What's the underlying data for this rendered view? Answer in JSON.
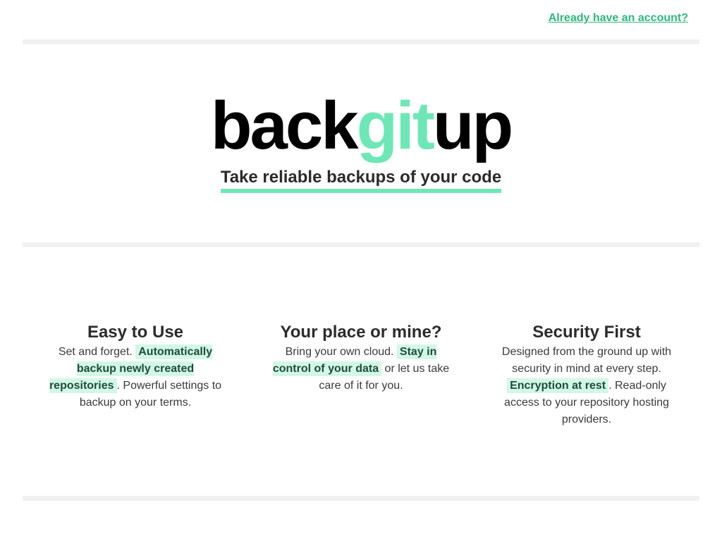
{
  "header": {
    "account_link": "Already have an account?"
  },
  "hero": {
    "logo_part1": "back",
    "logo_part2": "git",
    "logo_part3": "up",
    "tagline": "Take reliable backups of your code"
  },
  "features": [
    {
      "title": "Easy to Use",
      "text_before": "Set and forget. ",
      "highlight": "Automatically backup newly created repositories",
      "text_after": ". Powerful settings to backup on your terms."
    },
    {
      "title": "Your place or mine?",
      "text_before": "Bring your own cloud. ",
      "highlight": "Stay in control of your data",
      "text_after": " or let us take care of it for you."
    },
    {
      "title": "Security First",
      "text_before": "Designed from the ground up with security in mind at every step. ",
      "highlight": "Encryption at rest",
      "text_after": ". Read-only access to your repository hosting providers."
    }
  ],
  "colors": {
    "accent": "#6ee7b7",
    "link": "#2db87a",
    "highlight_bg": "#d3f7e7"
  }
}
